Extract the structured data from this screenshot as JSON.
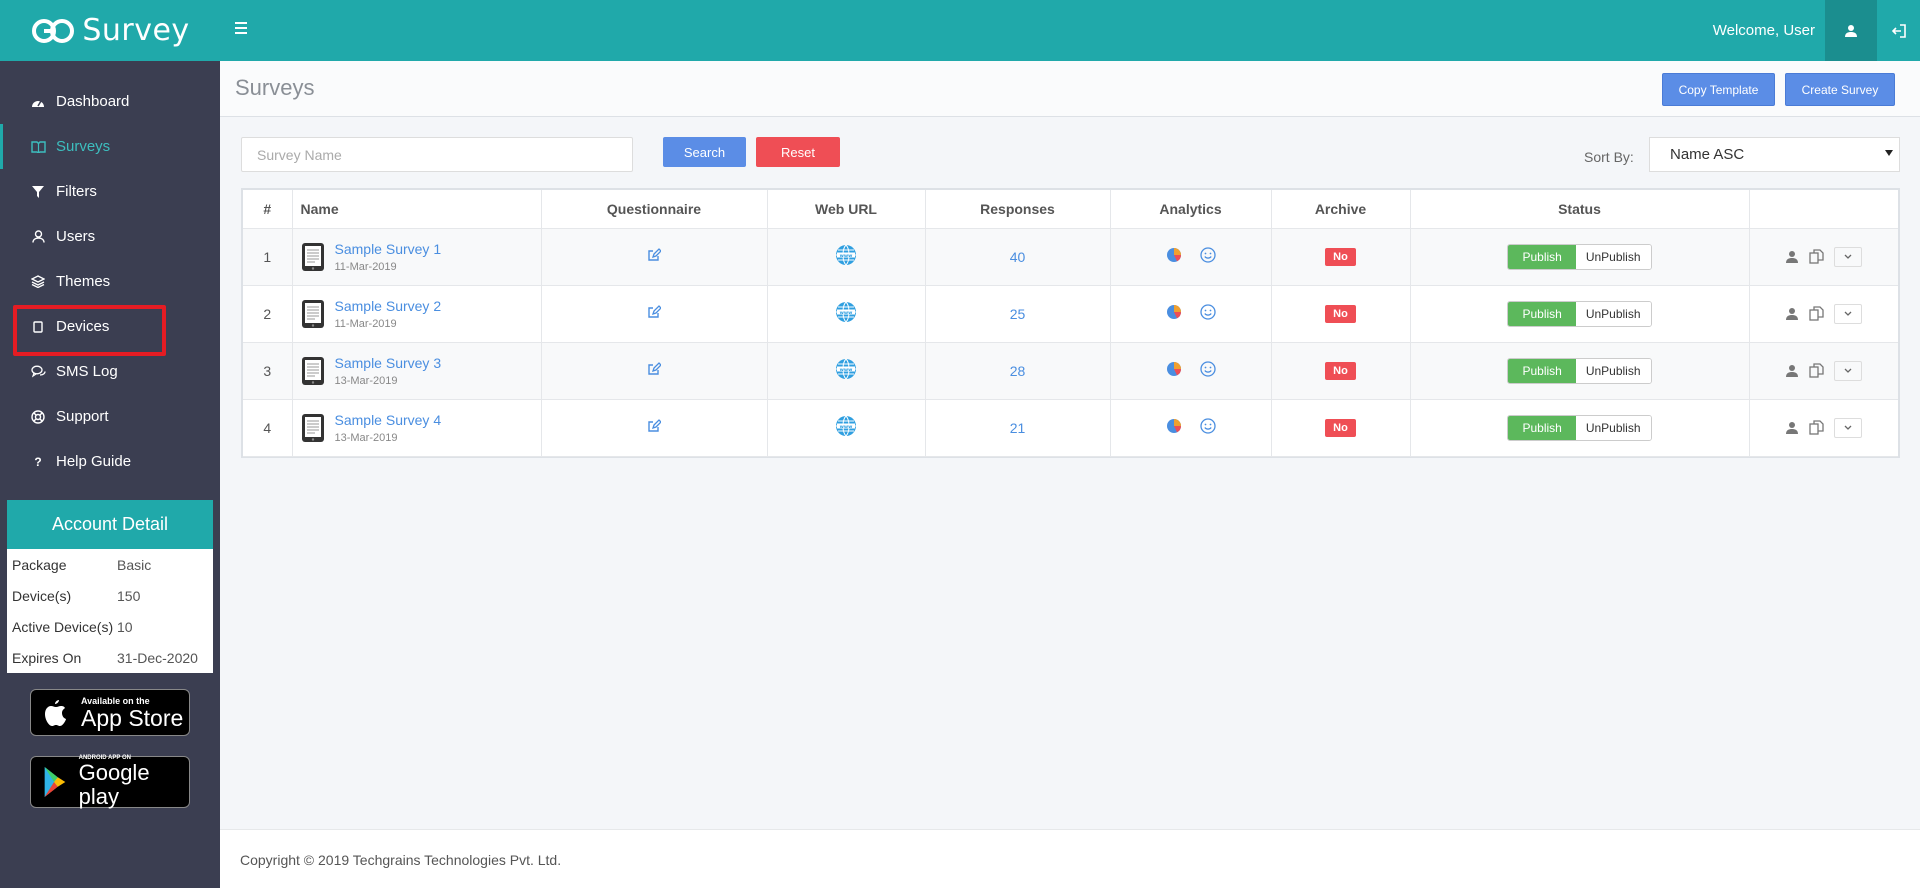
{
  "brand": {
    "name": "Survey"
  },
  "header": {
    "welcome": "Welcome, User"
  },
  "sidebar": {
    "items": [
      {
        "label": "Dashboard"
      },
      {
        "label": "Surveys"
      },
      {
        "label": "Filters"
      },
      {
        "label": "Users"
      },
      {
        "label": "Themes"
      },
      {
        "label": "Devices"
      },
      {
        "label": "SMS Log"
      },
      {
        "label": "Support"
      },
      {
        "label": "Help Guide"
      }
    ]
  },
  "account": {
    "title": "Account Detail",
    "rows": [
      {
        "key": "Package",
        "value": "Basic"
      },
      {
        "key": "Device(s)",
        "value": "150"
      },
      {
        "key": "Active Device(s)",
        "value": "10"
      },
      {
        "key": "Expires On",
        "value": "31-Dec-2020"
      }
    ]
  },
  "stores": {
    "apple": {
      "small": "Available on the",
      "big": "App Store"
    },
    "google": {
      "small": "ANDROID APP ON",
      "big": "Google play"
    }
  },
  "page": {
    "title": "Surveys",
    "copy_template": "Copy Template",
    "create_survey": "Create Survey"
  },
  "filters": {
    "search_placeholder": "Survey Name",
    "search_label": "Search",
    "reset_label": "Reset",
    "sort_label": "Sort By:",
    "sort_value": "Name ASC"
  },
  "table": {
    "headers": [
      "#",
      "Name",
      "Questionnaire",
      "Web URL",
      "Responses",
      "Analytics",
      "Archive",
      "Status",
      ""
    ],
    "rows": [
      {
        "num": "1",
        "name": "Sample Survey 1",
        "date": "11-Mar-2019",
        "responses": "40",
        "archive": "No",
        "publish": "Publish",
        "unpublish": "UnPublish"
      },
      {
        "num": "2",
        "name": "Sample Survey 2",
        "date": "11-Mar-2019",
        "responses": "25",
        "archive": "No",
        "publish": "Publish",
        "unpublish": "UnPublish"
      },
      {
        "num": "3",
        "name": "Sample Survey 3",
        "date": "13-Mar-2019",
        "responses": "28",
        "archive": "No",
        "publish": "Publish",
        "unpublish": "UnPublish"
      },
      {
        "num": "4",
        "name": "Sample Survey 4",
        "date": "13-Mar-2019",
        "responses": "21",
        "archive": "No",
        "publish": "Publish",
        "unpublish": "UnPublish"
      }
    ]
  },
  "footer": {
    "copyright": "Copyright © 2019 Techgrains Technologies Pvt. Ltd."
  },
  "colors": {
    "teal": "#20a9aa",
    "sidebar": "#3b3e51",
    "blue": "#5b8de6",
    "red": "#ef4e55",
    "green": "#5cb85c"
  }
}
